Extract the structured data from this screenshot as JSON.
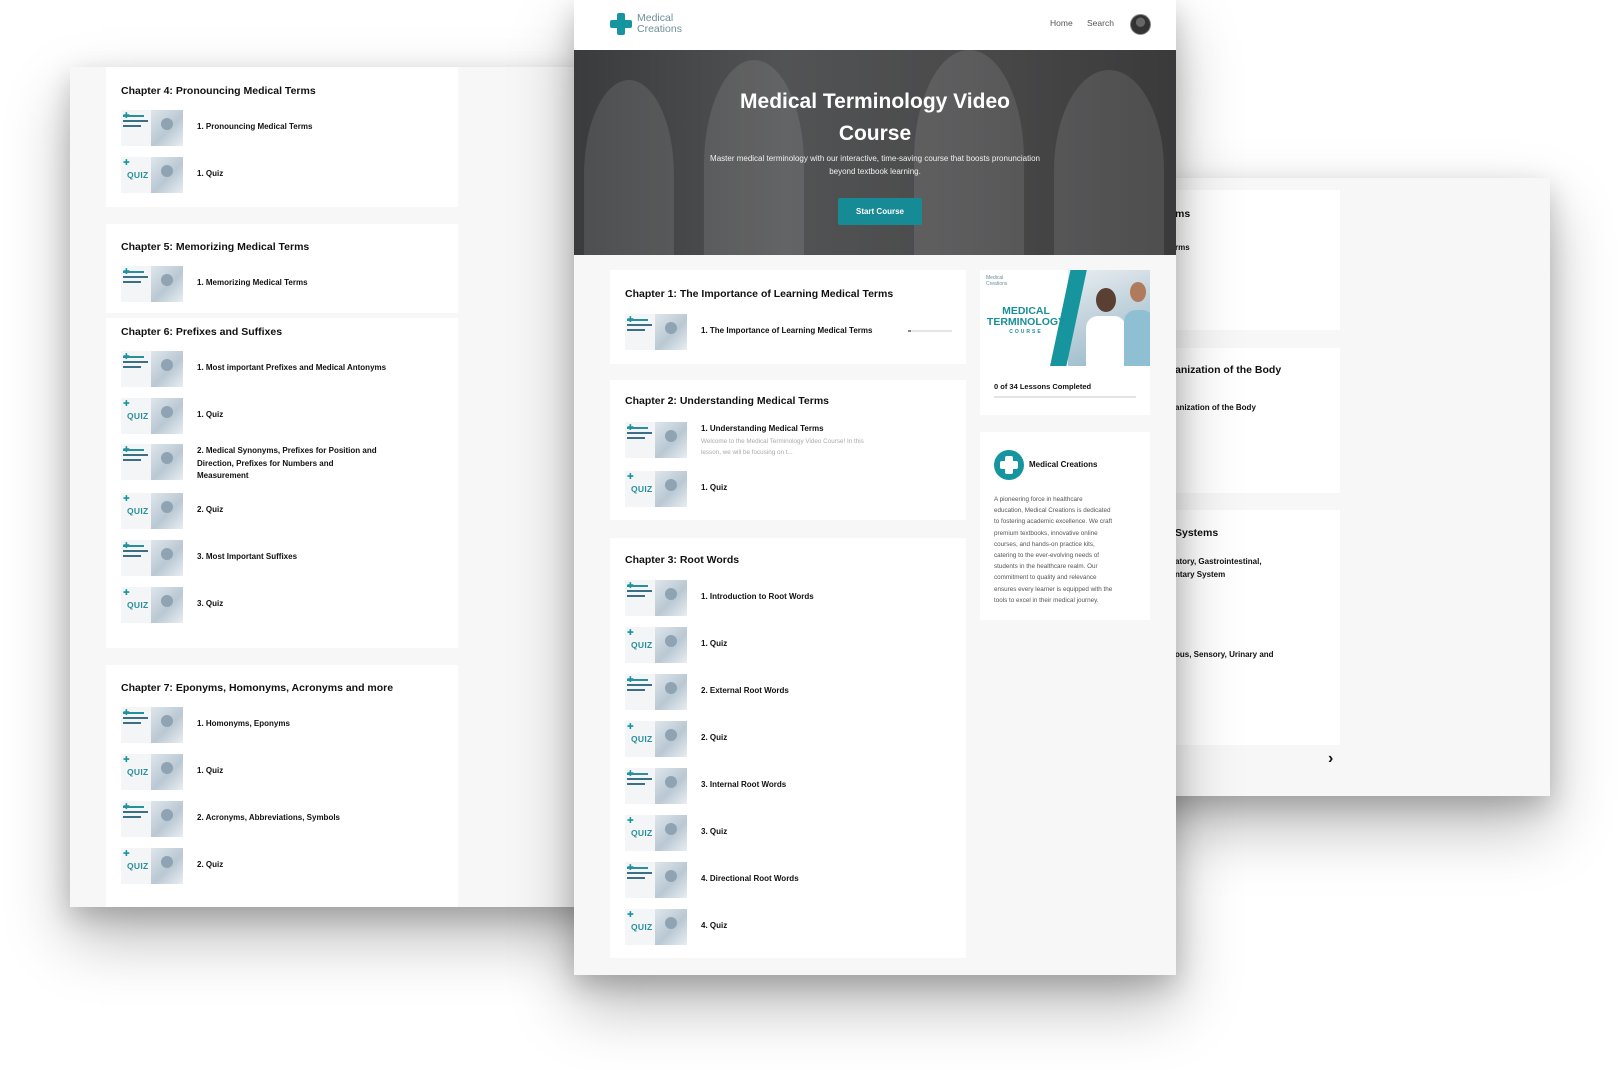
{
  "header": {
    "logo_line1": "Medical",
    "logo_line2": "Creations",
    "nav": [
      "Home",
      "Search"
    ]
  },
  "hero": {
    "title_line1": "Medical Terminology Video",
    "title_line2": "Course",
    "subtitle_line1": "Master medical terminology with our interactive, time-saving course that boosts pronunciation",
    "subtitle_line2": "beyond textbook learning.",
    "button": "Start Course"
  },
  "thumb_quiz": "QUIZ",
  "main_chapters": [
    {
      "title": "Chapter 1: The Importance of Learning Medical Terms",
      "lessons": [
        {
          "label": "1. The Importance of Learning Medical Terms"
        }
      ]
    },
    {
      "title": "Chapter 2: Understanding Medical Terms",
      "lessons": [
        {
          "label": "1. Understanding Medical Terms",
          "desc_line1": "Welcome to the Medical Terminology Video Course! In this",
          "desc_line2": "lesson, we will be focusing on t..."
        },
        {
          "label": "1. Quiz"
        }
      ]
    },
    {
      "title": "Chapter 3: Root Words",
      "lessons": [
        {
          "label": "1. Introduction to Root Words"
        },
        {
          "label": "1. Quiz"
        },
        {
          "label": "2. External Root Words"
        },
        {
          "label": "2. Quiz"
        },
        {
          "label": "3. Internal Root Words"
        },
        {
          "label": "3. Quiz"
        },
        {
          "label": "4. Directional Root Words"
        },
        {
          "label": "4. Quiz"
        }
      ]
    }
  ],
  "left_chapters": [
    {
      "title": "Chapter 4: Pronouncing Medical Terms",
      "lessons": [
        {
          "label": "1. Pronouncing Medical Terms"
        },
        {
          "label": "1. Quiz"
        }
      ]
    },
    {
      "title": "Chapter 5: Memorizing Medical Terms",
      "lessons": [
        {
          "label": "1. Memorizing Medical Terms"
        }
      ]
    },
    {
      "title": "Chapter 6: Prefixes and Suffixes",
      "lessons": [
        {
          "label": "1. Most important Prefixes and Medical Antonyms"
        },
        {
          "label": "1. Quiz"
        },
        {
          "label_line1": "2. Medical Synonyms, Prefixes for Position and",
          "label_line2": "Direction, Prefixes for Numbers and",
          "label_line3": "Measurement"
        },
        {
          "label": "2. Quiz"
        },
        {
          "label": "3. Most Important Suffixes"
        },
        {
          "label": "3. Quiz"
        }
      ]
    },
    {
      "title": "Chapter 7: Eponyms, Homonyms, Acronyms and more",
      "lessons": [
        {
          "label": "1. Homonyms, Eponyms"
        },
        {
          "label": "1. Quiz"
        },
        {
          "label": "2. Acronyms, Abbreviations, Symbols"
        },
        {
          "label": "2. Quiz"
        }
      ]
    }
  ],
  "right_fragments": {
    "t1": "ms",
    "t1_sub": "rms",
    "t2": "anization of the Body",
    "t2_sub": "anization of the Body",
    "t3": "Systems",
    "t3_sub1": "atory, Gastrointestinal,",
    "t3_sub2": "ntary System",
    "t3_sub3": "ous, Sensory, Urinary and",
    "next_arrow": "›"
  },
  "course_card": {
    "logo_line1": "Medical",
    "logo_line2": "Creations",
    "title_line1": "MEDICAL",
    "title_line2": "TERMINOLOGY",
    "title_line3": "COURSE",
    "progress_text": "0 of 34 Lessons Completed",
    "progress_fraction": 0
  },
  "about": {
    "name": "Medical Creations",
    "text_lines": [
      "A pioneering force in healthcare",
      "education, Medical Creations is dedicated",
      "to fostering academic excellence. We craft",
      "premium textbooks, innovative online",
      "courses, and hands-on practice kits,",
      "catering to the ever-evolving needs of",
      "students in the healthcare realm. Our",
      "commitment to quality and relevance",
      "ensures every learner is equipped with the",
      "tools to excel in their medical journey."
    ]
  },
  "colors": {
    "accent": "#17959f",
    "button": "#168a95",
    "page_bg": "#f7f7f7",
    "card_bg": "#ffffff"
  }
}
